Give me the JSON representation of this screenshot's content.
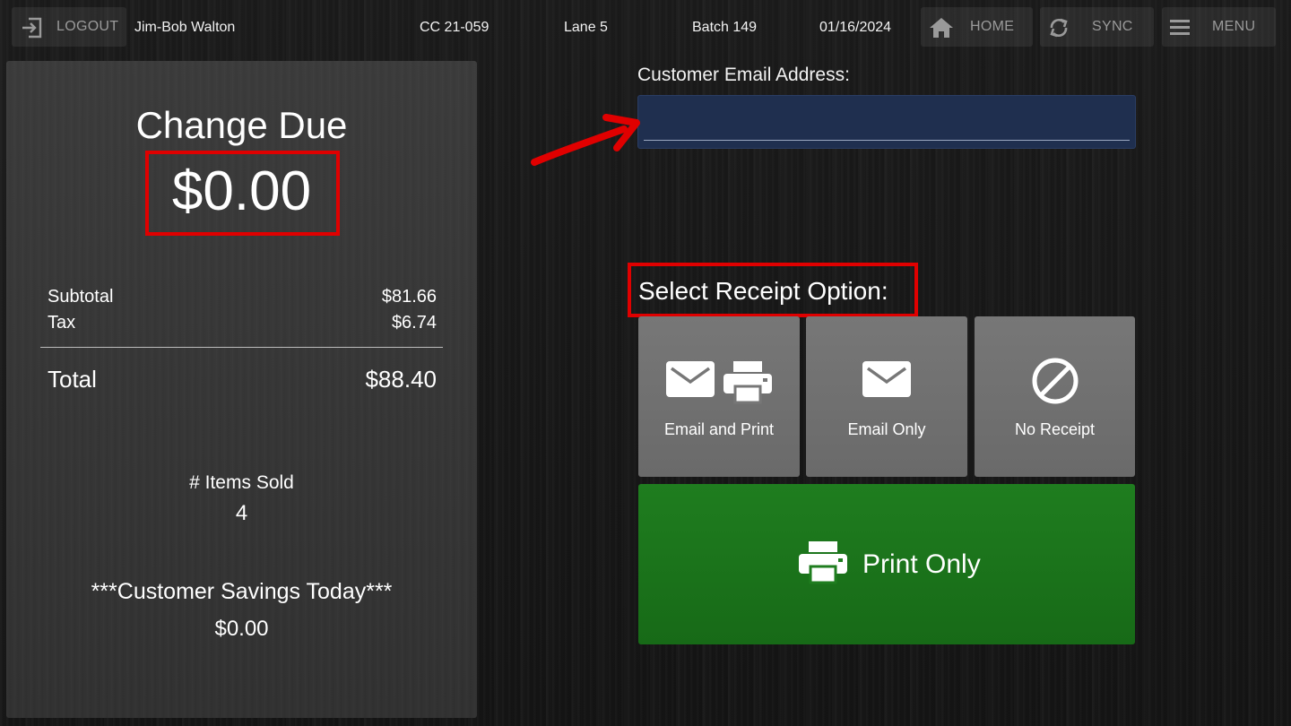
{
  "topbar": {
    "logout_label": "LOGOUT",
    "user_name": "Jim-Bob Walton",
    "register_id": "CC 21-059",
    "lane": "Lane 5",
    "batch": "Batch 149",
    "date": "01/16/2024",
    "home_label": "HOME",
    "sync_label": "SYNC",
    "menu_label": "MENU",
    "icons": [
      "logout-icon",
      "home-icon",
      "sync-icon",
      "menu-icon"
    ]
  },
  "summary": {
    "change_due_title": "Change Due",
    "change_due_amount": "$0.00",
    "subtotal_label": "Subtotal",
    "subtotal_value": "$81.66",
    "tax_label": "Tax",
    "tax_value": "$6.74",
    "total_label": "Total",
    "total_value": "$88.40",
    "items_sold_label": "# Items Sold",
    "items_sold_value": "4",
    "savings_label": "***Customer Savings Today***",
    "savings_value": "$0.00"
  },
  "email": {
    "label": "Customer Email Address:",
    "value": ""
  },
  "receipt": {
    "title": "Select Receipt Option:",
    "options": [
      {
        "label": "Email and Print",
        "icons": [
          "envelope-icon",
          "printer-icon"
        ]
      },
      {
        "label": "Email Only",
        "icons": [
          "envelope-icon"
        ]
      },
      {
        "label": "No Receipt",
        "icons": [
          "no-symbol-icon"
        ]
      }
    ],
    "print_only_label": "Print Only"
  },
  "colors": {
    "highlight_red": "#e00000",
    "print_green": "#1f7d1f",
    "email_field_blue": "#1f2f4f",
    "option_gray": "#777777"
  }
}
